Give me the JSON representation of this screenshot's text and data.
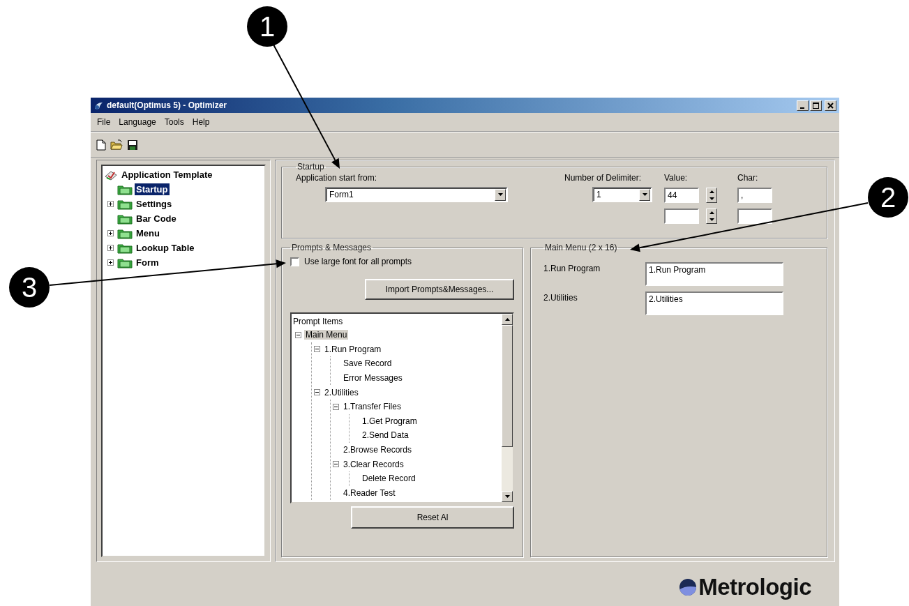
{
  "window": {
    "title": "default(Optimus 5) - Optimizer"
  },
  "menu": [
    "File",
    "Language",
    "Tools",
    "Help"
  ],
  "nav_tree": {
    "root": "Application Template",
    "items": [
      {
        "label": "Startup",
        "kind": "leaf",
        "selected": true
      },
      {
        "label": "Settings",
        "kind": "branch",
        "selected": false
      },
      {
        "label": "Bar Code",
        "kind": "leaf",
        "selected": false
      },
      {
        "label": "Menu",
        "kind": "branch",
        "selected": false
      },
      {
        "label": "Lookup Table",
        "kind": "branch",
        "selected": false
      },
      {
        "label": "Form",
        "kind": "branch",
        "selected": false
      }
    ]
  },
  "startup": {
    "legend": "Startup",
    "start_label": "Application start from:",
    "start_value": "Form1",
    "delimiter_label": "Number of Delimiter:",
    "delimiter_value": "1",
    "value_label": "Value:",
    "values": [
      "44"
    ],
    "char_label": "Char:",
    "chars": [
      ","
    ]
  },
  "prompts": {
    "legend": "Prompts & Messages",
    "large_font": {
      "label": "Use large font for all prompts",
      "checked": false
    },
    "import_button": "Import Prompts&Messages...",
    "list_header": "Prompt Items",
    "items": [
      {
        "label": "Main Menu",
        "selected": true,
        "expanded": true,
        "children": [
          {
            "label": "1.Run Program",
            "selected": false,
            "expanded": true,
            "children": [
              {
                "label": "Save Record",
                "selected": false,
                "expanded": false
              },
              {
                "label": "Error Messages",
                "selected": false,
                "expanded": false
              }
            ]
          },
          {
            "label": "2.Utilities",
            "selected": false,
            "expanded": true,
            "children": [
              {
                "label": "1.Transfer Files",
                "selected": false,
                "expanded": true,
                "children": [
                  {
                    "label": "1.Get Program",
                    "selected": false,
                    "expanded": false
                  },
                  {
                    "label": "2.Send Data",
                    "selected": false,
                    "expanded": false
                  }
                ]
              },
              {
                "label": "2.Browse Records",
                "selected": false,
                "expanded": false
              },
              {
                "label": "3.Clear Records",
                "selected": false,
                "expanded": true,
                "children": [
                  {
                    "label": "Delete Record",
                    "selected": false,
                    "expanded": false
                  }
                ]
              },
              {
                "label": "4.Reader Test",
                "selected": false,
                "expanded": false
              }
            ]
          }
        ]
      }
    ],
    "reset_button": "Reset Al"
  },
  "main_menu": {
    "legend": "Main Menu (2 x 16)",
    "rows": [
      {
        "label": "1.Run Program",
        "value": "1.Run Program"
      },
      {
        "label": "2.Utilities",
        "value": "2.Utilities"
      }
    ]
  },
  "logo": "Metrologic",
  "callouts": [
    {
      "label": "1"
    },
    {
      "label": "2"
    },
    {
      "label": "3"
    }
  ]
}
